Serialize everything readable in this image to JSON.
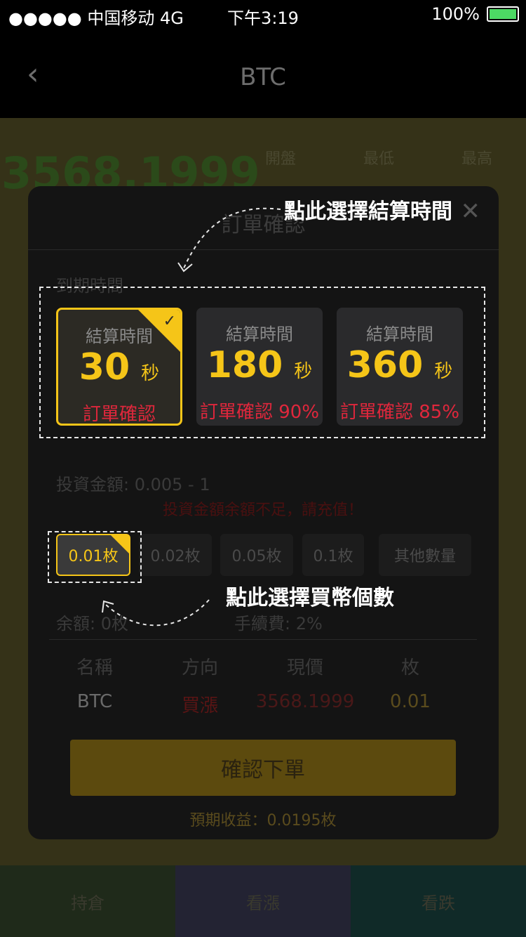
{
  "status_bar": {
    "carrier": "●●●●● 中国移动  4G",
    "time": "下午3:19",
    "battery": "100%"
  },
  "nav": {
    "title": "BTC",
    "back": "‹"
  },
  "background": {
    "price": "3568.1999",
    "cols": [
      "開盤",
      "最低",
      "最高"
    ],
    "tabs": [
      "持倉",
      "看漲",
      "看跌"
    ]
  },
  "modal": {
    "title": "訂單確認",
    "close": "✕",
    "expiry_label": "到期時間",
    "cards": [
      {
        "label": "結算時間",
        "value": "30",
        "unit": "秒",
        "foot": "訂單確認"
      },
      {
        "label": "結算時間",
        "value": "180",
        "unit": "秒",
        "foot": "訂單確認 90%"
      },
      {
        "label": "結算時間",
        "value": "360",
        "unit": "秒",
        "foot": "訂單確認 85%"
      }
    ],
    "invest_label": "投資金額: 0.005 - 1",
    "insufficient": "投資金額余額不足，請充值！",
    "chips": [
      "0.01枚",
      "0.02枚",
      "0.05枚",
      "0.1枚",
      "其他數量"
    ],
    "balance": "余額: 0枚",
    "fee": "手續費: 2%",
    "table_headers": [
      "名稱",
      "方向",
      "現價",
      "枚"
    ],
    "table_values": [
      "BTC",
      "買漲",
      "3568.1999",
      "0.01"
    ],
    "confirm": "確認下單",
    "expected": "預期收益：0.0195枚"
  },
  "annotations": {
    "time_hint": "點此選擇結算時間",
    "coin_hint": "點此選擇買幣個數"
  },
  "colors": {
    "accent": "#f5c518",
    "danger": "#e0273c",
    "confirm": "#5c4a0e"
  }
}
